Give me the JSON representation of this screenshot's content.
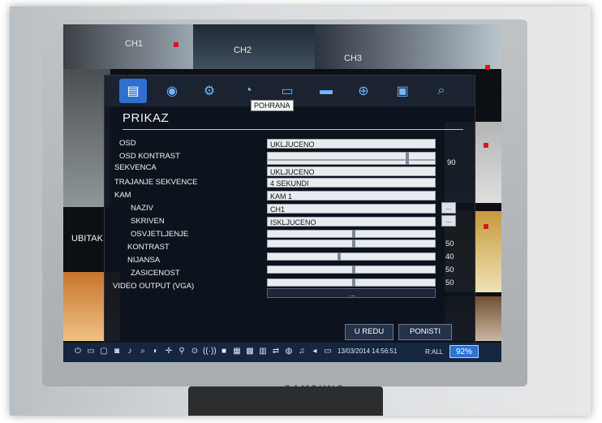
{
  "monitor": {
    "brand": "SAMSUNG"
  },
  "screen": {
    "channels": [
      "CH1",
      "CH2",
      "CH3"
    ],
    "side_label": "UBITAK"
  },
  "menu": {
    "title": "PRIKAZ",
    "tooltip": "POHRANA",
    "tabs": [
      {
        "icon": "display-icon"
      },
      {
        "icon": "disc-icon"
      },
      {
        "icon": "gear-icon"
      },
      {
        "icon": "storage-icon"
      },
      {
        "icon": "network-icon"
      },
      {
        "icon": "chat-icon"
      },
      {
        "icon": "globe-icon"
      },
      {
        "icon": "device-icon"
      },
      {
        "icon": "search-icon"
      }
    ],
    "rows": {
      "osd": {
        "label": "OSD",
        "value": "UKLJUCENO"
      },
      "osd_kontrast": {
        "label": "OSD KONTRAST",
        "value": 90
      },
      "sekvenca": {
        "label": "SEKVENCA",
        "value": "UKLJUCENO"
      },
      "trajanje": {
        "label": "TRAJANJE SEKVENCE",
        "value": "4 SEKUNDI"
      },
      "kam": {
        "label": "KAM",
        "value": "KAM 1"
      },
      "naziv": {
        "label": "NAZIV",
        "value": "CH1",
        "button": "..."
      },
      "skriven": {
        "label": "SKRIVEN",
        "value": "ISKLJUCENO",
        "button": "..."
      },
      "osvjetljenje": {
        "label": "OSVJETLJENJE",
        "value": 50
      },
      "kontrast": {
        "label": "KONTRAST",
        "value": 50
      },
      "nijansa": {
        "label": "NIJANSA",
        "value": 40
      },
      "zasicenost": {
        "label": "ZASICENOST",
        "value": 50
      },
      "video_output": {
        "label": "VIDEO OUTPUT (VGA)",
        "value": "..."
      }
    },
    "ok_label": "U REDU",
    "cancel_label": "PONISTI"
  },
  "taskbar": {
    "datetime": "13/03/2014 14:56:51",
    "r_all": "R:ALL",
    "zoom": "92%"
  },
  "colors": {
    "accent": "#2f6fd0",
    "panel": "#0e141e",
    "taskbar": "#15263f"
  }
}
